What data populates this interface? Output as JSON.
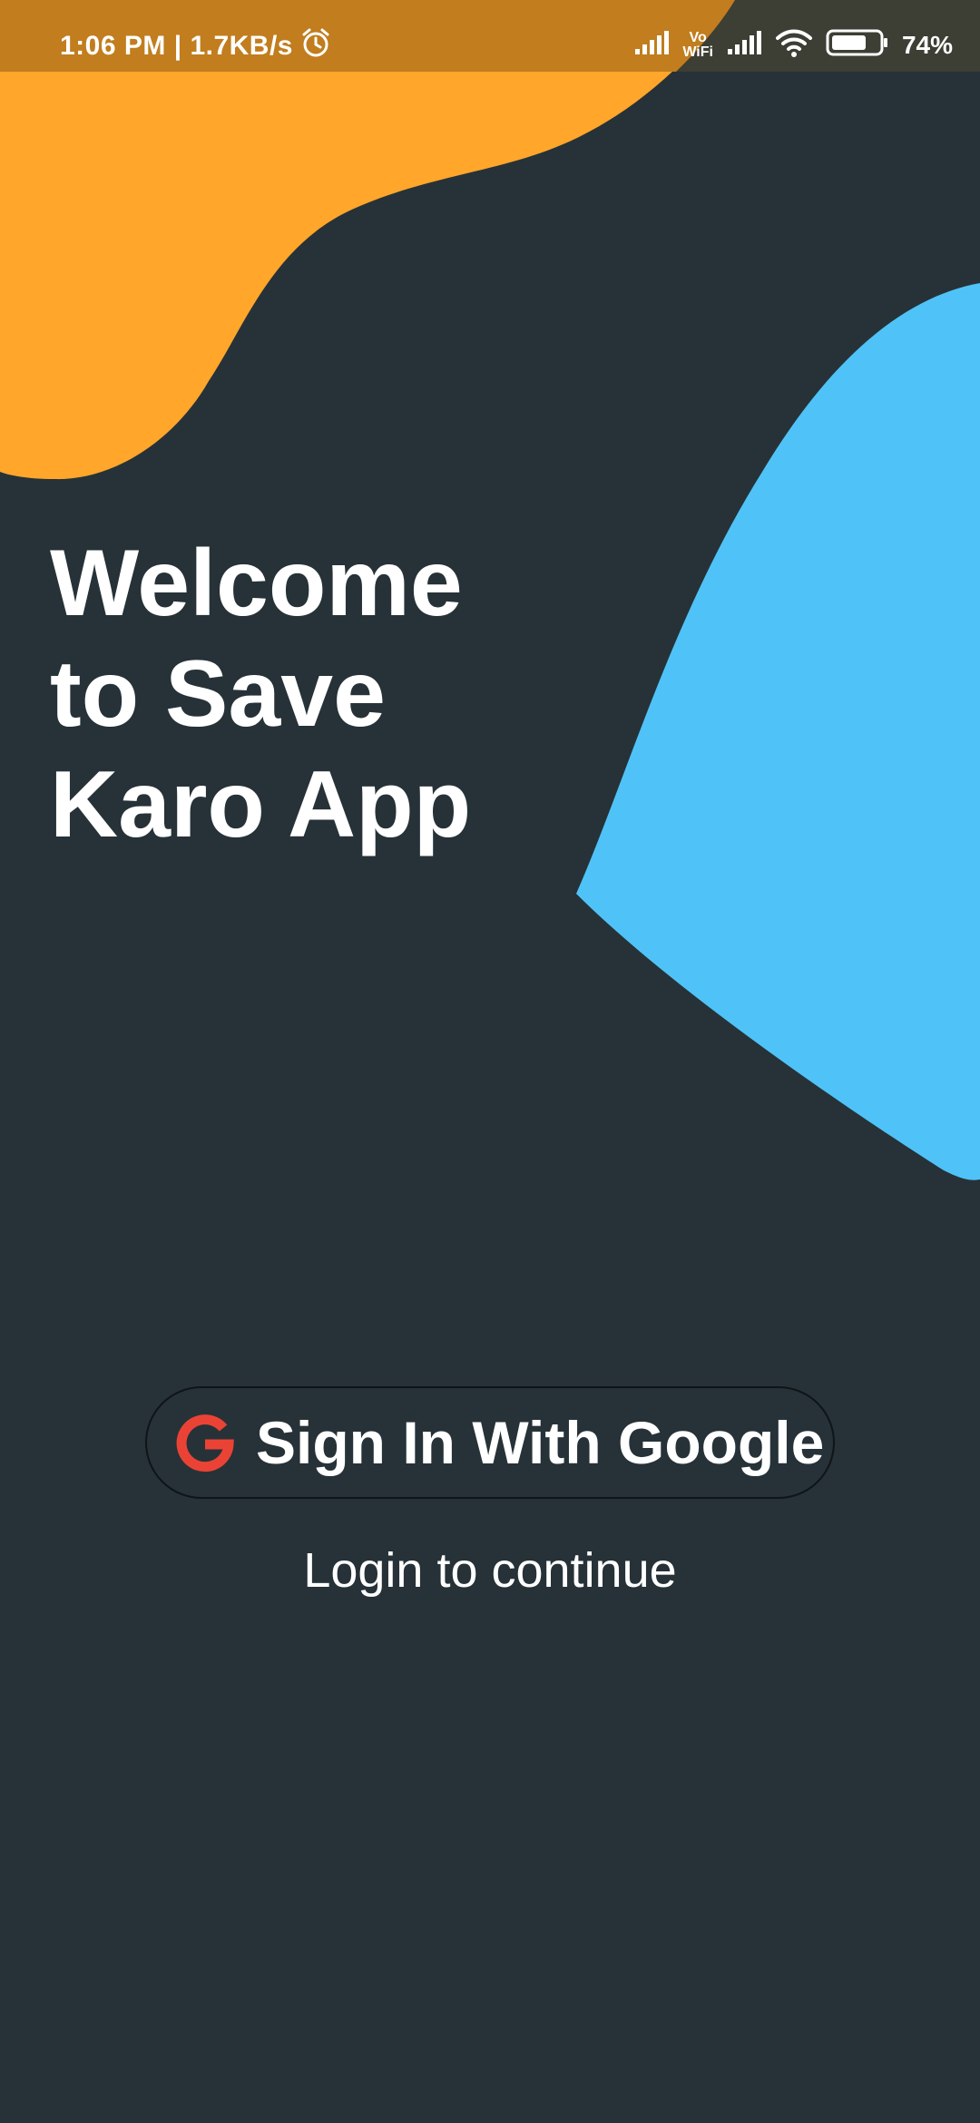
{
  "status_bar": {
    "time_speed": "1:06 PM | 1.7KB/s",
    "alarm_icon": "alarm-clock-icon",
    "signal_icon": "cell-signal-icon",
    "vowifi_top": "Vo",
    "vowifi_bottom": "WiFi",
    "wifi_icon": "wifi-icon",
    "battery_icon": "battery-icon",
    "battery_level": 0.74,
    "battery_text": "74%"
  },
  "welcome": {
    "title_line1": "Welcome",
    "title_line2": "to Save",
    "title_line3": "Karo App"
  },
  "sign_in": {
    "icon": "google-g-icon",
    "label": "Sign In With Google"
  },
  "login_caption": "Login to continue",
  "colors": {
    "background": "#263238",
    "orange_blob": "#FFA62B",
    "status_bar": "#C17D1E",
    "blue_blob": "#4FC3F7",
    "google_red": "#EA4335",
    "text": "#FFFFFF"
  }
}
